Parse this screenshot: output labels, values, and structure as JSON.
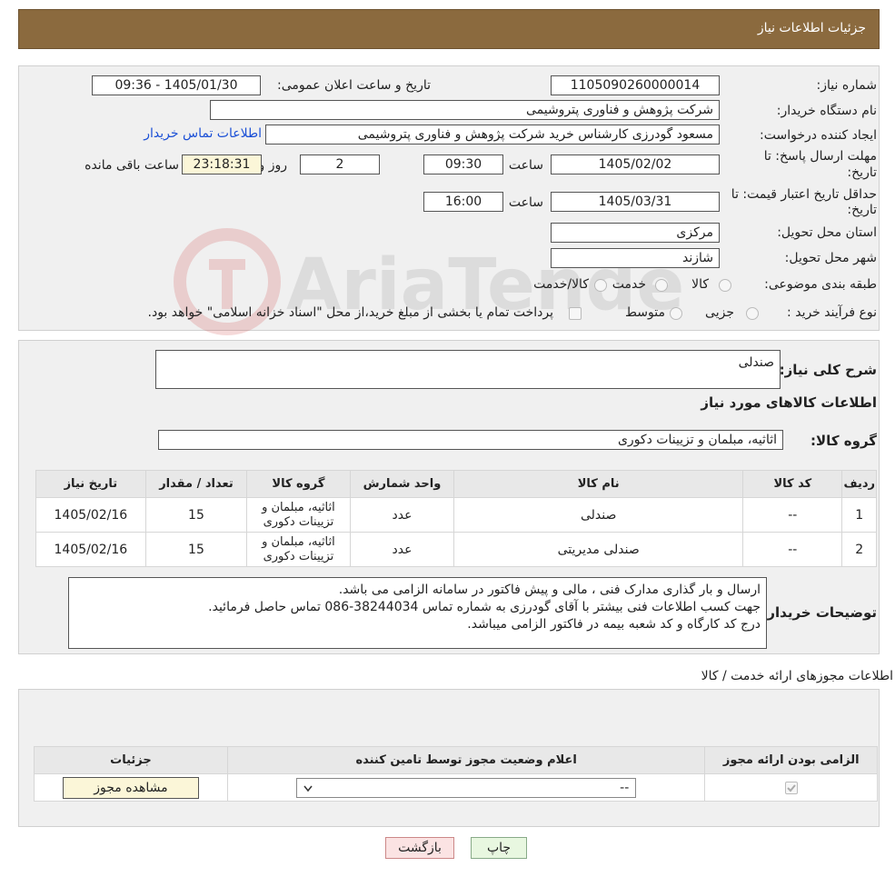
{
  "header": {
    "title": "جزئیات اطلاعات نیاز"
  },
  "form": {
    "need_number_label": "شماره نیاز:",
    "need_number": "1105090260000014",
    "announce_label": "تاریخ و ساعت اعلان عمومی:",
    "announce_value": "1405/01/30 - 09:36",
    "buyer_org_label": "نام دستگاه خریدار:",
    "buyer_org": "شرکت پژوهش و فناوری پتروشیمی",
    "creator_label": "ایجاد کننده درخواست:",
    "creator": "مسعود گودرزی کارشناس خرید شرکت پژوهش و فناوری پتروشیمی",
    "contact_link": "اطلاعات تماس خریدار",
    "deadline_label_1": "مهلت ارسال پاسخ: تا",
    "deadline_label_2": "تاریخ:",
    "deadline_date": "1405/02/02",
    "time_label": "ساعت",
    "deadline_time": "09:30",
    "days_value": "2",
    "days_label": "روز و",
    "remaining_time": "23:18:31",
    "remaining_label": "ساعت باقی مانده",
    "validity_label_1": "حداقل تاریخ اعتبار قیمت: تا",
    "validity_label_2": "تاریخ:",
    "validity_date": "1405/03/31",
    "validity_time": "16:00",
    "province_label": "استان محل تحویل:",
    "province": "مرکزی",
    "city_label": "شهر محل تحویل:",
    "city": "شازند",
    "category_label": "طبقه بندی موضوعی:",
    "category_options": [
      "کالا",
      "خدمت",
      "کالا/خدمت"
    ],
    "process_label": "نوع فرآیند خرید :",
    "process_options": [
      "جزیی",
      "متوسط"
    ],
    "process_note": "پرداخت تمام یا بخشی از مبلغ خرید،از محل \"اسناد خزانه اسلامی\" خواهد بود."
  },
  "description": {
    "summary_label": "شرح کلی نیاز:",
    "summary": "صندلی",
    "goods_info_title": "اطلاعات کالاهای مورد نیاز",
    "goods_group_label": "گروه کالا:",
    "goods_group": "اثاثیه، مبلمان و تزیینات دکوری"
  },
  "items_table": {
    "headers": [
      "ردیف",
      "کد کالا",
      "نام کالا",
      "واحد شمارش",
      "گروه کالا",
      "تعداد / مقدار",
      "تاریخ نیاز"
    ],
    "rows": [
      [
        "1",
        "--",
        "صندلی",
        "عدد",
        "اثاثیه، مبلمان و تزیینات دکوری",
        "15",
        "1405/02/16"
      ],
      [
        "2",
        "--",
        "صندلی مدیریتی",
        "عدد",
        "اثاثیه، مبلمان و تزیینات دکوری",
        "15",
        "1405/02/16"
      ]
    ]
  },
  "buyer_notes": {
    "label": "توضیحات خریدار:",
    "lines": [
      "ارسال و بار گذاری مدارک فنی ، مالی و پیش فاکتور در سامانه الزامی می باشد.",
      "جهت کسب اطلاعات فنی بیشتر با آقای گودرزی به شماره تماس 38244034-086 تماس حاصل فرمائید.",
      "درج کد کارگاه و کد شعبه بیمه  در فاکتور الزامی میباشد."
    ]
  },
  "permits": {
    "title": "اطلاعات مجوزهای ارائه خدمت / کالا",
    "headers": [
      "الزامی بودن ارائه مجوز",
      "اعلام وضعیت مجوز توسط تامین کننده",
      "جزئیات"
    ],
    "select_value": "--",
    "view_button": "مشاهده مجوز"
  },
  "footer": {
    "print_button": "چاپ",
    "back_button": "بازگشت"
  },
  "colors": {
    "header_bg": "#8b6a3e",
    "yellow_box": "#fbf6d8",
    "link": "#1a4fd6",
    "back_button_bg": "#fbe3e3",
    "print_button_bg": "#e8f7e0"
  }
}
